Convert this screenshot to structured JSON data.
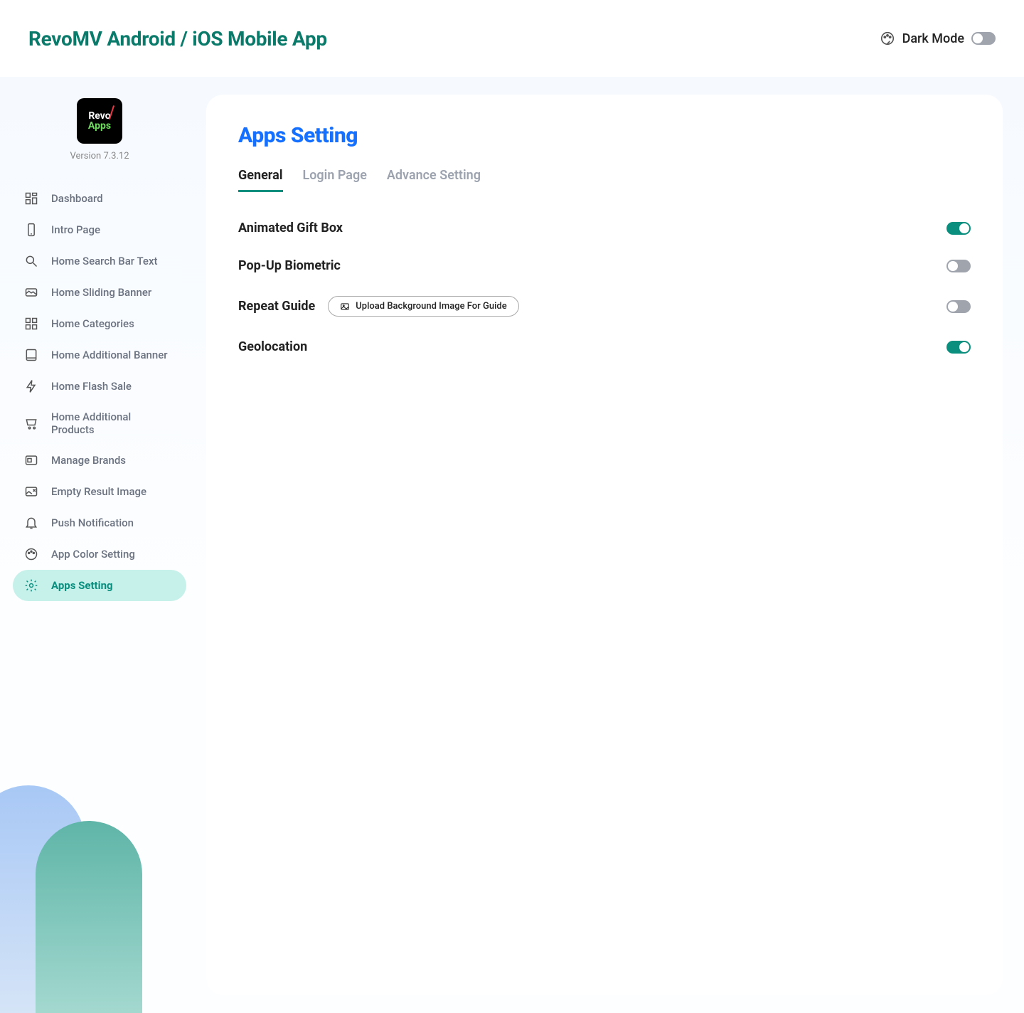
{
  "header": {
    "title": "RevoMV Android / iOS Mobile App",
    "darkModeLabel": "Dark Mode",
    "darkModeOn": false
  },
  "sidebar": {
    "logo": {
      "line1": "Revo",
      "line2": "Apps"
    },
    "version": "Version 7.3.12",
    "items": [
      {
        "label": "Dashboard",
        "icon": "dashboard"
      },
      {
        "label": "Intro Page",
        "icon": "phone"
      },
      {
        "label": "Home Search Bar Text",
        "icon": "search"
      },
      {
        "label": "Home Sliding Banner",
        "icon": "banner"
      },
      {
        "label": "Home Categories",
        "icon": "grid"
      },
      {
        "label": "Home Additional Banner",
        "icon": "tablet"
      },
      {
        "label": "Home Flash Sale",
        "icon": "bolt"
      },
      {
        "label": "Home Additional Products",
        "icon": "cart"
      },
      {
        "label": "Manage Brands",
        "icon": "brand"
      },
      {
        "label": "Empty Result Image",
        "icon": "image-x"
      },
      {
        "label": "Push Notification",
        "icon": "bell"
      },
      {
        "label": "App Color Setting",
        "icon": "palette"
      },
      {
        "label": "Apps Setting",
        "icon": "gear",
        "active": true
      }
    ]
  },
  "main": {
    "title": "Apps Setting",
    "tabs": [
      {
        "label": "General",
        "active": true
      },
      {
        "label": "Login Page"
      },
      {
        "label": "Advance Setting"
      }
    ],
    "settings": [
      {
        "label": "Animated Gift Box",
        "on": true
      },
      {
        "label": "Pop-Up Biometric",
        "on": false
      },
      {
        "label": "Repeat Guide",
        "on": false,
        "uploadLabel": "Upload Background Image For Guide"
      },
      {
        "label": "Geolocation",
        "on": true
      }
    ]
  }
}
